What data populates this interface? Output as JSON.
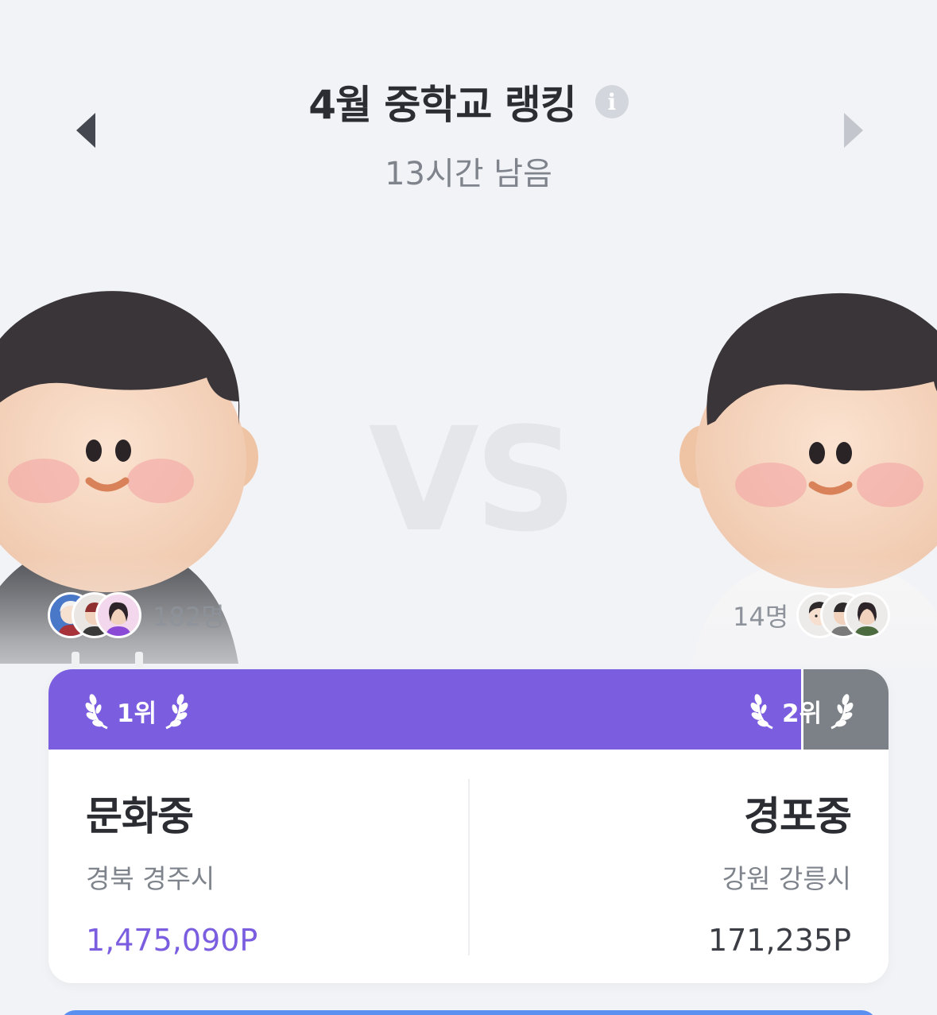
{
  "header": {
    "title": "4월 중학교 랭킹",
    "remaining": "13시간 남음",
    "info_icon": "info-icon",
    "prev_icon": "triangle-left-icon",
    "next_icon": "triangle-right-icon"
  },
  "vs_label": "VS",
  "matchup": {
    "left": {
      "participants_count": "182명",
      "rank_label": "1위",
      "school_name": "문화중",
      "region": "경북 경주시",
      "points": "1,475,090P"
    },
    "right": {
      "participants_count": "14명",
      "rank_label": "2위",
      "school_name": "경포중",
      "region": "강원 강릉시",
      "points": "171,235P"
    },
    "score_share_left": 0.896
  },
  "colors": {
    "accent": "#7b5ee0",
    "secondary_bar": "#7c8087",
    "background": "#f2f3f6",
    "bottom_button": "#5b8ff0"
  }
}
